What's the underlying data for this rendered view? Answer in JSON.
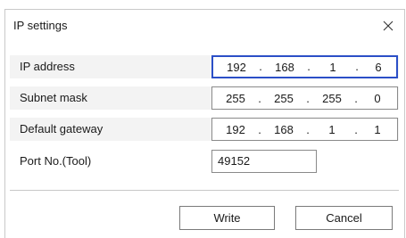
{
  "dialog": {
    "title": "IP settings",
    "close_glyph": "×"
  },
  "fields": {
    "ip_address": {
      "label": "IP address",
      "octets": [
        "192",
        "168",
        "1",
        "6"
      ]
    },
    "subnet_mask": {
      "label": "Subnet mask",
      "octets": [
        "255",
        "255",
        "255",
        "0"
      ]
    },
    "default_gateway": {
      "label": "Default gateway",
      "octets": [
        "192",
        "168",
        "1",
        "1"
      ]
    },
    "port": {
      "label": "Port No.(Tool)",
      "value": "49152"
    }
  },
  "separator_glyph": ".",
  "buttons": {
    "write_label": "Write",
    "cancel_label": "Cancel"
  },
  "colors": {
    "focus_border": "#2b4fc7",
    "row_background": "#f3f3f3"
  },
  "icons": {
    "close": "close-icon"
  }
}
